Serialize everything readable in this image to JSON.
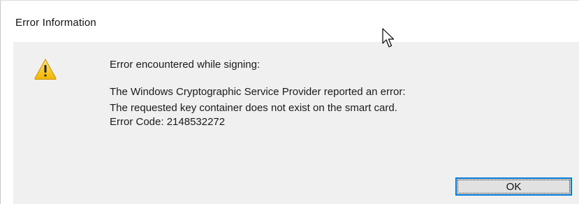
{
  "dialog": {
    "title": "Error Information",
    "heading": "Error encountered while signing:",
    "message_lines": [
      "The Windows Cryptographic Service Provider reported an error:",
      "The requested key container does not exist on the smart card.",
      "Error Code: 2148532272"
    ],
    "ok_label": "OK"
  },
  "icons": {
    "warning": "warning-icon",
    "cursor": "mouse-pointer-icon"
  },
  "colors": {
    "content_background": "#f0f0f0",
    "button_focus_border": "#0078d7",
    "warning_fill": "#f5c400"
  }
}
